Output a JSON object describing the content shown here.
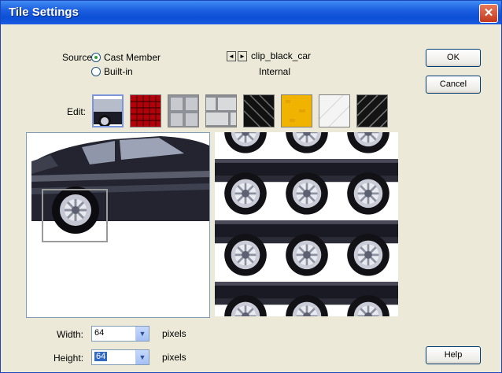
{
  "window": {
    "title": "Tile Settings",
    "close_glyph": "✕"
  },
  "source": {
    "label": "Source:",
    "options": [
      {
        "label": "Cast Member",
        "checked": true
      },
      {
        "label": "Built-in",
        "checked": false
      }
    ]
  },
  "member": {
    "prev_glyph": "◄",
    "next_glyph": "►",
    "name": "clip_black_car",
    "location": "Internal"
  },
  "buttons": {
    "ok": "OK",
    "cancel": "Cancel",
    "help": "Help"
  },
  "edit": {
    "label": "Edit:",
    "swatches": [
      "car",
      "red-grid",
      "gray-panels",
      "gray-brick",
      "black-stripes",
      "yellow",
      "white",
      "black-diagonal"
    ],
    "selected_index": 0
  },
  "size": {
    "width_label": "Width:",
    "width_value": "64",
    "height_label": "Height:",
    "height_value": "64",
    "unit": "pixels"
  },
  "colors": {
    "title_bar": "#1c5fe0",
    "dialog_bg": "#ece9d8",
    "radio_check": "#2e9e3a",
    "selection": "#316ac5"
  },
  "icons": [
    "close-icon",
    "radio-icon",
    "prev-arrow-icon",
    "next-arrow-icon",
    "dropdown-arrow-icon"
  ]
}
